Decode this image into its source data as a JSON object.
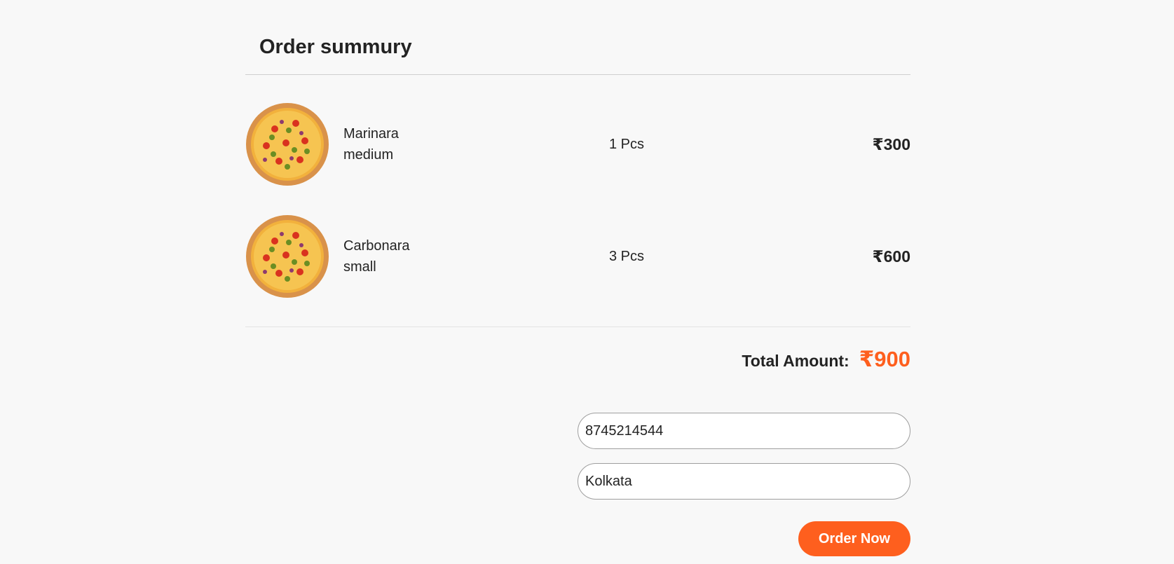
{
  "page": {
    "title": "Order summury"
  },
  "items": [
    {
      "name_line1": "Marinara",
      "name_line2": "medium",
      "qty": "1 Pcs",
      "price": "₹300"
    },
    {
      "name_line1": "Carbonara",
      "name_line2": "small",
      "qty": "3 Pcs",
      "price": "₹600"
    }
  ],
  "summary": {
    "total_label": "Total Amount:",
    "total_value": "₹900"
  },
  "form": {
    "phone_value": "8745214544",
    "address_value": "Kolkata",
    "order_button_label": "Order Now"
  },
  "colors": {
    "accent": "#fe5f1e",
    "background": "#f8f8f8"
  },
  "icons": {
    "item_image": "pizza-image"
  }
}
